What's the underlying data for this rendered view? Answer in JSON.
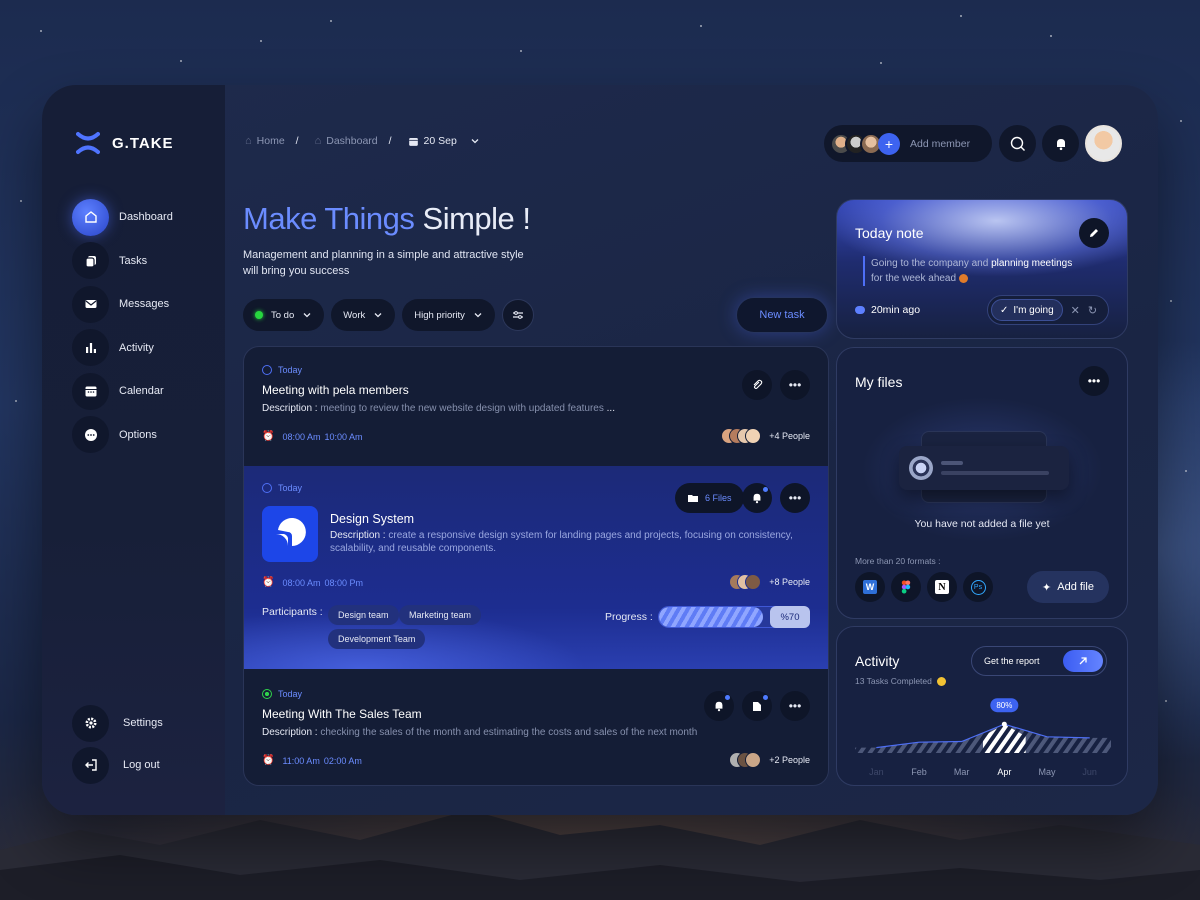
{
  "brand": {
    "name": "G.TAKE"
  },
  "sidebar": {
    "items": [
      {
        "label": "Dashboard",
        "icon": "home-icon",
        "active": true
      },
      {
        "label": "Tasks",
        "icon": "tasks-icon"
      },
      {
        "label": "Messages",
        "icon": "mail-icon"
      },
      {
        "label": "Activity",
        "icon": "bar-chart-icon"
      },
      {
        "label": "Calendar",
        "icon": "calendar-icon"
      },
      {
        "label": "Options",
        "icon": "options-icon"
      }
    ],
    "bottom": [
      {
        "label": "Settings",
        "icon": "gear-icon"
      },
      {
        "label": "Log out",
        "icon": "logout-icon"
      }
    ]
  },
  "topbar": {
    "breadcrumb": [
      "Home",
      "Dashboard"
    ],
    "date": "20 Sep",
    "add_member": "Add member"
  },
  "hero": {
    "title_accent": "Make Things",
    "title_rest": " Simple !",
    "subtitle": "Management and planning in a simple and attractive style will bring you success"
  },
  "filters": {
    "status": "To do",
    "category": "Work",
    "priority": "High priority",
    "new_task": "New task"
  },
  "tasks": [
    {
      "tag": "Today",
      "title": "Meeting with pela members",
      "desc_label": "Description :",
      "desc": "meeting to review the new website design with updated features",
      "desc_ellipsis": "...",
      "start": "08:00 Am",
      "end": "10:00 Am",
      "people": "+4 People"
    },
    {
      "tag": "Today",
      "title": "Design System",
      "desc_label": "Description :",
      "desc": "create a responsive design system for landing pages and projects, focusing on consistency,",
      "desc2": "scalability, and reusable components.",
      "files": "6 Files",
      "start": "08:00 Am",
      "end": "08:00 Pm",
      "people": "+8 People",
      "participants_label": "Participants :",
      "teams": [
        "Design team",
        "Marketing team",
        "Development Team"
      ],
      "progress_label": "Progress :",
      "progress": 0.7,
      "progress_text": "%70"
    },
    {
      "tag": "Today",
      "title": "Meeting With The Sales Team",
      "desc_label": "Description :",
      "desc": "checking the sales of the month and estimating the costs and sales of the next month",
      "start": "11:00 Am",
      "end": "02:00 Am",
      "people": "+2 People"
    }
  ],
  "note": {
    "title": "Today note",
    "text_a": "Going to the company and ",
    "text_b": "planning meetings",
    "text_c": "for the week ahead",
    "time": "20min ago",
    "going": "I'm going"
  },
  "files": {
    "title": "My files",
    "empty": "You have not added a file yet",
    "formats": "More than 20 formats :",
    "format_icons": [
      "word-icon",
      "figma-icon",
      "notion-icon",
      "photoshop-icon"
    ],
    "add": "Add file"
  },
  "activity": {
    "title": "Activity",
    "subtitle": "13 Tasks Completed",
    "report": "Get the report",
    "chart_data": {
      "type": "line",
      "categories": [
        "Jan",
        "Feb",
        "Mar",
        "Apr",
        "May",
        "Jun"
      ],
      "highlight": "Apr",
      "highlight_label": "80%",
      "values": [
        15,
        30,
        32,
        80,
        45,
        42
      ]
    }
  },
  "colors": {
    "accent": "#6b8cff",
    "primary": "#3d63f0",
    "success": "#27d63f",
    "background": "#1a2544"
  }
}
